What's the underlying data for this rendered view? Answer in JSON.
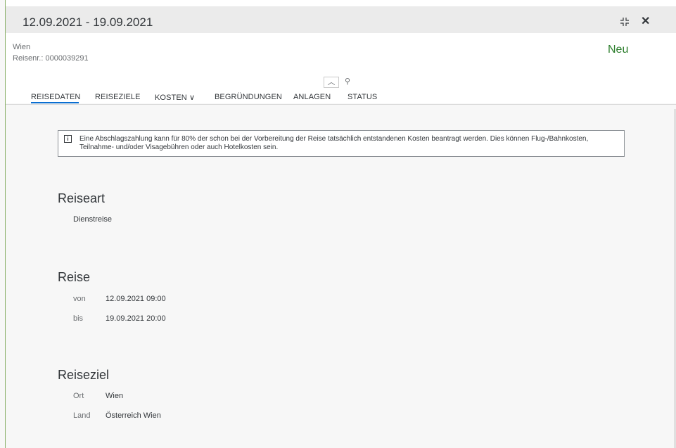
{
  "header": {
    "title": "12.09.2021 - 19.09.2021"
  },
  "object": {
    "location": "Wien",
    "trip_number": "Reisenr.: 0000039291",
    "status": "Neu",
    "status_color": "#2b7d2b"
  },
  "tabs": [
    {
      "label": "REISEDATEN"
    },
    {
      "label": "REISEZIELE"
    },
    {
      "label": "KOSTEN ∨"
    },
    {
      "label": "BEGRÜNDUNGEN"
    },
    {
      "label": "ANLAGEN"
    },
    {
      "label": "STATUS"
    }
  ],
  "info": {
    "text": "Eine Abschlagszahlung kann für 80% der schon bei der Vorbereitung der Reise tatsächlich entstandenen Kosten beantragt werden. Dies können Flug-/Bahnkosten, Teilnahme- und/oder Visagebühren oder auch Hotelkosten sein."
  },
  "reiseart": {
    "title": "Reiseart",
    "value": "Dienstreise"
  },
  "reise": {
    "title": "Reise",
    "von_label": "von",
    "von_value": "12.09.2021  09:00",
    "bis_label": "bis",
    "bis_value": "19.09.2021  20:00"
  },
  "reiseziel": {
    "title": "Reiseziel",
    "ort_label": "Ort",
    "ort_value": "Wien",
    "land_label": "Land",
    "land_value": "Österreich Wien"
  },
  "colors": {
    "accent": "#0a6ed1",
    "header_bg": "#ebebeb"
  }
}
